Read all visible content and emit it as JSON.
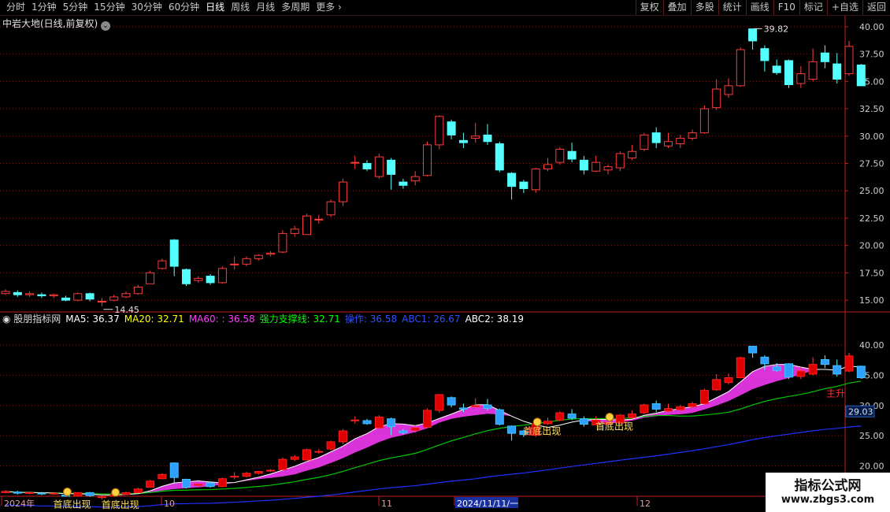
{
  "toolbar": {
    "periods": [
      "分时",
      "1分钟",
      "5分钟",
      "15分钟",
      "30分钟",
      "60分钟",
      "日线",
      "周线",
      "月线",
      "多周期",
      "更多"
    ],
    "active_period": "日线",
    "tools": [
      "复权",
      "叠加",
      "多股",
      "统计",
      "画线",
      "F10",
      "标记",
      "+自选",
      "返回"
    ]
  },
  "main": {
    "title": "中岩大地(日线,前复权)",
    "high_label": "39.82",
    "low_label": "14.45",
    "y_ticks": [
      "40.00",
      "37.50",
      "35.00",
      "32.50",
      "30.00",
      "27.50",
      "25.00",
      "22.50",
      "20.00",
      "17.50",
      "15.00"
    ]
  },
  "sub": {
    "indicator_name": "股朋指标网",
    "legend": [
      {
        "label": "MA5: 36.37",
        "color": "#ffffff"
      },
      {
        "label": "MA20: 32.71",
        "color": "#ffff00"
      },
      {
        "label": "MA60: : 36.58",
        "color": "#ff3cff"
      },
      {
        "label": "强力支撑线: 32.71",
        "color": "#00ff00"
      },
      {
        "label": "操作: 36.58",
        "color": "#3050ff"
      },
      {
        "label": "ABC1: 26.67",
        "color": "#3050ff"
      },
      {
        "label": "ABC2: 38.19",
        "color": "#ffffff"
      }
    ],
    "y_ticks": [
      "40.00",
      "35.00",
      "30.00",
      "25.00",
      "20.00"
    ],
    "price_tag": "29.03",
    "signals": [
      {
        "text": "首底出现"
      },
      {
        "text": "首底出现"
      },
      {
        "text": "首底出现"
      },
      {
        "text": "首底出现"
      }
    ],
    "main_lift_1": "主",
    "main_lift_2": "主升"
  },
  "axis": {
    "labels": [
      "2024年",
      "10",
      "11",
      "2024/11/11/一",
      "12"
    ]
  },
  "watermark": {
    "line1": "指标公式网",
    "line2": "www.zbgs3.com"
  },
  "chart_data": {
    "type": "candlestick",
    "title": "中岩大地(日线,前复权)",
    "ylim_main": [
      14.0,
      41.0
    ],
    "ylim_sub": [
      15.0,
      43.0
    ],
    "candles": [
      {
        "o": 15.6,
        "c": 15.8,
        "h": 16.0,
        "l": 15.5
      },
      {
        "o": 15.7,
        "c": 15.5,
        "h": 15.9,
        "l": 15.3
      },
      {
        "o": 15.5,
        "c": 15.6,
        "h": 15.8,
        "l": 15.3
      },
      {
        "o": 15.5,
        "c": 15.4,
        "h": 15.7,
        "l": 15.2
      },
      {
        "o": 15.4,
        "c": 15.5,
        "h": 15.6,
        "l": 15.2
      },
      {
        "o": 15.2,
        "c": 15.0,
        "h": 15.4,
        "l": 14.9
      },
      {
        "o": 15.0,
        "c": 15.6,
        "h": 15.7,
        "l": 14.9
      },
      {
        "o": 15.6,
        "c": 15.1,
        "h": 15.7,
        "l": 14.9
      },
      {
        "o": 14.9,
        "c": 14.9,
        "h": 15.2,
        "l": 14.45
      },
      {
        "o": 15.0,
        "c": 15.3,
        "h": 15.5,
        "l": 14.9
      },
      {
        "o": 15.3,
        "c": 15.6,
        "h": 15.8,
        "l": 15.2
      },
      {
        "o": 15.6,
        "c": 16.2,
        "h": 16.4,
        "l": 15.5
      },
      {
        "o": 16.5,
        "c": 17.5,
        "h": 17.7,
        "l": 16.5
      },
      {
        "o": 17.9,
        "c": 18.6,
        "h": 18.8,
        "l": 17.8
      },
      {
        "o": 20.5,
        "c": 18.1,
        "h": 20.6,
        "l": 17.2
      },
      {
        "o": 17.8,
        "c": 16.5,
        "h": 17.9,
        "l": 16.3
      },
      {
        "o": 16.8,
        "c": 17.0,
        "h": 17.2,
        "l": 16.6
      },
      {
        "o": 17.2,
        "c": 16.6,
        "h": 17.4,
        "l": 16.4
      },
      {
        "o": 16.6,
        "c": 17.9,
        "h": 18.1,
        "l": 16.5
      },
      {
        "o": 18.3,
        "c": 18.3,
        "h": 19.0,
        "l": 17.8
      },
      {
        "o": 18.3,
        "c": 18.8,
        "h": 19.0,
        "l": 18.1
      },
      {
        "o": 18.8,
        "c": 19.1,
        "h": 19.2,
        "l": 18.6
      },
      {
        "o": 19.2,
        "c": 19.3,
        "h": 19.5,
        "l": 19.0
      },
      {
        "o": 19.4,
        "c": 21.1,
        "h": 21.4,
        "l": 19.3
      },
      {
        "o": 21.1,
        "c": 21.5,
        "h": 21.8,
        "l": 20.8
      },
      {
        "o": 21.0,
        "c": 22.7,
        "h": 22.9,
        "l": 21.0
      },
      {
        "o": 22.4,
        "c": 22.4,
        "h": 22.8,
        "l": 22.0
      },
      {
        "o": 22.8,
        "c": 24.0,
        "h": 24.2,
        "l": 22.6
      },
      {
        "o": 24.0,
        "c": 25.8,
        "h": 26.1,
        "l": 23.6
      },
      {
        "o": 27.6,
        "c": 27.6,
        "h": 28.2,
        "l": 27.0
      },
      {
        "o": 27.5,
        "c": 27.0,
        "h": 27.8,
        "l": 26.8
      },
      {
        "o": 26.3,
        "c": 28.1,
        "h": 28.4,
        "l": 26.1
      },
      {
        "o": 27.8,
        "c": 26.5,
        "h": 28.0,
        "l": 25.1
      },
      {
        "o": 25.8,
        "c": 25.5,
        "h": 26.1,
        "l": 25.2
      },
      {
        "o": 25.9,
        "c": 26.3,
        "h": 26.8,
        "l": 25.5
      },
      {
        "o": 26.4,
        "c": 29.2,
        "h": 29.5,
        "l": 26.3
      },
      {
        "o": 29.2,
        "c": 31.8,
        "h": 31.9,
        "l": 28.8
      },
      {
        "o": 31.3,
        "c": 30.1,
        "h": 31.5,
        "l": 29.7
      },
      {
        "o": 29.6,
        "c": 29.4,
        "h": 30.3,
        "l": 28.9
      },
      {
        "o": 29.8,
        "c": 30.0,
        "h": 31.2,
        "l": 29.4
      },
      {
        "o": 30.1,
        "c": 29.5,
        "h": 31.1,
        "l": 29.2
      },
      {
        "o": 29.3,
        "c": 26.9,
        "h": 29.5,
        "l": 26.7
      },
      {
        "o": 26.6,
        "c": 25.4,
        "h": 26.7,
        "l": 24.2
      },
      {
        "o": 25.8,
        "c": 25.2,
        "h": 26.0,
        "l": 24.8
      },
      {
        "o": 25.1,
        "c": 27.0,
        "h": 27.1,
        "l": 24.8
      },
      {
        "o": 27.0,
        "c": 27.4,
        "h": 28.0,
        "l": 26.8
      },
      {
        "o": 27.6,
        "c": 28.8,
        "h": 29.0,
        "l": 27.4
      },
      {
        "o": 28.6,
        "c": 27.9,
        "h": 29.4,
        "l": 27.6
      },
      {
        "o": 27.8,
        "c": 26.9,
        "h": 28.2,
        "l": 26.5
      },
      {
        "o": 26.8,
        "c": 27.6,
        "h": 28.2,
        "l": 26.7
      },
      {
        "o": 26.9,
        "c": 27.2,
        "h": 27.4,
        "l": 26.5
      },
      {
        "o": 27.1,
        "c": 28.4,
        "h": 28.6,
        "l": 26.8
      },
      {
        "o": 28.0,
        "c": 28.6,
        "h": 29.2,
        "l": 27.8
      },
      {
        "o": 28.8,
        "c": 30.1,
        "h": 30.3,
        "l": 28.6
      },
      {
        "o": 30.3,
        "c": 29.4,
        "h": 30.8,
        "l": 28.9
      },
      {
        "o": 29.1,
        "c": 29.5,
        "h": 30.3,
        "l": 28.9
      },
      {
        "o": 29.3,
        "c": 29.8,
        "h": 30.1,
        "l": 28.9
      },
      {
        "o": 29.8,
        "c": 30.3,
        "h": 30.6,
        "l": 29.6
      },
      {
        "o": 30.3,
        "c": 32.5,
        "h": 32.8,
        "l": 30.2
      },
      {
        "o": 32.6,
        "c": 34.3,
        "h": 35.2,
        "l": 32.4
      },
      {
        "o": 33.8,
        "c": 34.6,
        "h": 35.3,
        "l": 33.5
      },
      {
        "o": 34.6,
        "c": 37.9,
        "h": 38.1,
        "l": 34.5
      },
      {
        "o": 39.8,
        "c": 38.7,
        "h": 39.82,
        "l": 37.9
      },
      {
        "o": 38.0,
        "c": 36.9,
        "h": 38.3,
        "l": 35.9
      },
      {
        "o": 36.4,
        "c": 35.8,
        "h": 37.0,
        "l": 35.6
      },
      {
        "o": 36.9,
        "c": 34.7,
        "h": 37.0,
        "l": 34.4
      },
      {
        "o": 34.8,
        "c": 35.7,
        "h": 36.4,
        "l": 34.4
      },
      {
        "o": 35.2,
        "c": 36.8,
        "h": 38.0,
        "l": 35.0
      },
      {
        "o": 37.6,
        "c": 36.8,
        "h": 38.3,
        "l": 36.2
      },
      {
        "o": 36.6,
        "c": 35.2,
        "h": 37.6,
        "l": 34.8
      },
      {
        "o": 35.7,
        "c": 38.2,
        "h": 38.7,
        "l": 35.5
      },
      {
        "o": 36.5,
        "c": 34.6,
        "h": 36.6,
        "l": 34.6
      }
    ],
    "colors": {
      "up": "#ff3c3c",
      "down": "#54ffff",
      "grid": "#7a1818",
      "axis": "#c02020",
      "ma5": "#ffffff",
      "support": "#00c800",
      "abc1": "#2030ff",
      "cloud": "#ff3cff"
    }
  }
}
